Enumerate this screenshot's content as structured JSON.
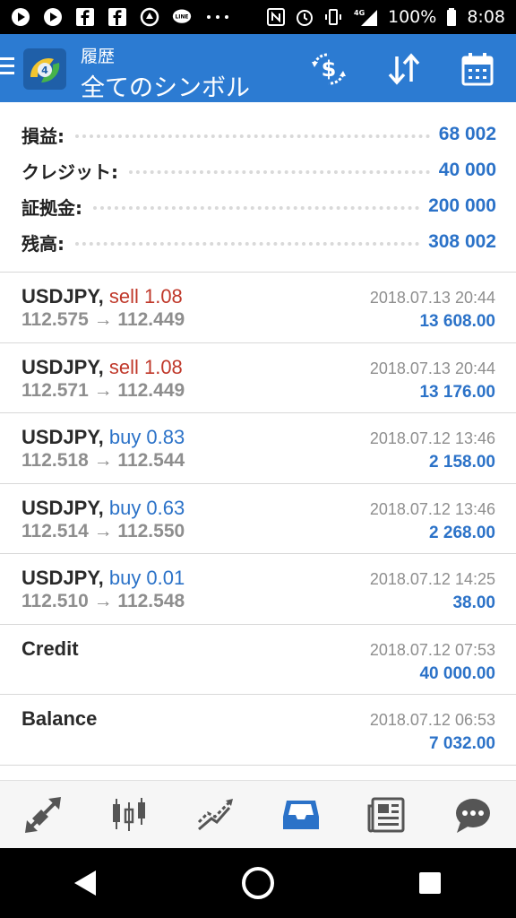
{
  "status_bar": {
    "battery": "100%",
    "time": "8:08",
    "network": "4G"
  },
  "header": {
    "subtitle": "履歴",
    "title": "全てのシンボル"
  },
  "summary": [
    {
      "label": "損益:",
      "value": "68 002"
    },
    {
      "label": "クレジット:",
      "value": "40 000"
    },
    {
      "label": "証拠金:",
      "value": "200 000"
    },
    {
      "label": "残高:",
      "value": "308 002"
    }
  ],
  "history": [
    {
      "symbol": "USDJPY,",
      "side": "sell",
      "side_text": "sell 1.08",
      "prices": "112.575 → 112.449",
      "date": "2018.07.13 20:44",
      "profit": "13 608.00"
    },
    {
      "symbol": "USDJPY,",
      "side": "sell",
      "side_text": "sell 1.08",
      "prices": "112.571 → 112.449",
      "date": "2018.07.13 20:44",
      "profit": "13 176.00"
    },
    {
      "symbol": "USDJPY,",
      "side": "buy",
      "side_text": "buy 0.83",
      "prices": "112.518 → 112.544",
      "date": "2018.07.12 13:46",
      "profit": "2 158.00"
    },
    {
      "symbol": "USDJPY,",
      "side": "buy",
      "side_text": "buy 0.63",
      "prices": "112.514 → 112.550",
      "date": "2018.07.12 13:46",
      "profit": "2 268.00"
    },
    {
      "symbol": "USDJPY,",
      "side": "buy",
      "side_text": "buy 0.01",
      "prices": "112.510 → 112.548",
      "date": "2018.07.12 14:25",
      "profit": "38.00"
    },
    {
      "symbol": "Credit",
      "side": "",
      "side_text": "",
      "prices": "",
      "date": "2018.07.12 07:53",
      "profit": "40 000.00"
    },
    {
      "symbol": "Balance",
      "side": "",
      "side_text": "",
      "prices": "",
      "date": "2018.07.12 06:53",
      "profit": "7 032.00"
    }
  ],
  "bottom_nav": {
    "active": "history",
    "items": [
      "trade-arrows-icon",
      "candlestick-icon",
      "chart-lines-icon",
      "inbox-icon",
      "news-icon",
      "chat-icon"
    ]
  },
  "colors": {
    "appbar": "#2c7bd2",
    "profit": "#2b72c8",
    "sell": "#c0392b",
    "buy": "#2b72c8"
  }
}
